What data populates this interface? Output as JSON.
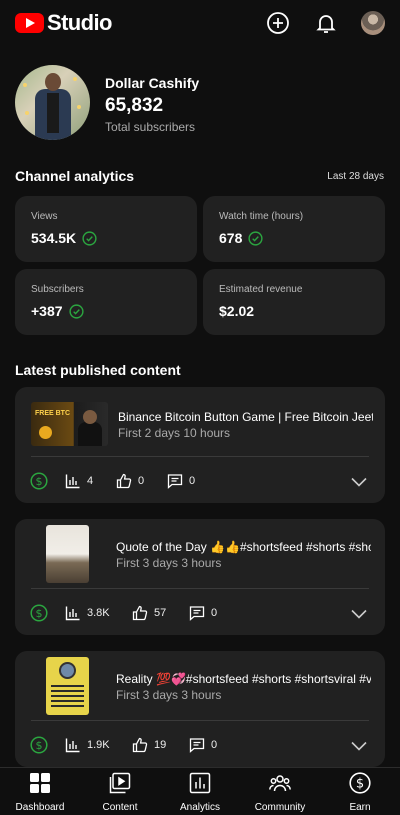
{
  "header": {
    "logo_text": "Studio",
    "create_icon": "plus-circle-icon",
    "notifications_icon": "bell-icon",
    "account_icon": "avatar"
  },
  "channel": {
    "name": "Dollar Cashify",
    "subscribers": "65,832",
    "subscribers_label": "Total subscribers"
  },
  "analytics": {
    "title": "Channel analytics",
    "period": "Last 28 days",
    "cards": [
      {
        "label": "Views",
        "value": "534.5K",
        "verified": true
      },
      {
        "label": "Watch time (hours)",
        "value": "678",
        "verified": true
      },
      {
        "label": "Subscribers",
        "value": "+387",
        "verified": true
      },
      {
        "label": "Estimated revenue",
        "value": "$2.02",
        "verified": false
      }
    ]
  },
  "latest": {
    "title": "Latest published content",
    "items": [
      {
        "title": "Binance Bitcoin Button Game | Free Bitcoin Jeetn...",
        "subtitle": "First 2 days 10 hours",
        "thumb_text": "FREE BTC",
        "views": "4",
        "likes": "0",
        "comments": "0"
      },
      {
        "title": "Quote of the Day 👍👍#shortsfeed #shorts #shor...",
        "subtitle": "First 3 days 3 hours",
        "views": "3.8K",
        "likes": "57",
        "comments": "0"
      },
      {
        "title": "Reality 💯💞#shortsfeed #shorts #shortsviral #vir...",
        "subtitle": "First 3 days 3 hours",
        "views": "1.9K",
        "likes": "19",
        "comments": "0"
      }
    ]
  },
  "colors": {
    "brand_red": "#ff0000",
    "check_green": "#2ba640",
    "card_bg": "#212121",
    "page_bg": "#0f0f0f"
  },
  "nav": {
    "items": [
      {
        "label": "Dashboard",
        "icon": "dashboard-icon"
      },
      {
        "label": "Content",
        "icon": "content-icon"
      },
      {
        "label": "Analytics",
        "icon": "analytics-icon"
      },
      {
        "label": "Community",
        "icon": "community-icon"
      },
      {
        "label": "Earn",
        "icon": "dollar-icon"
      }
    ]
  }
}
